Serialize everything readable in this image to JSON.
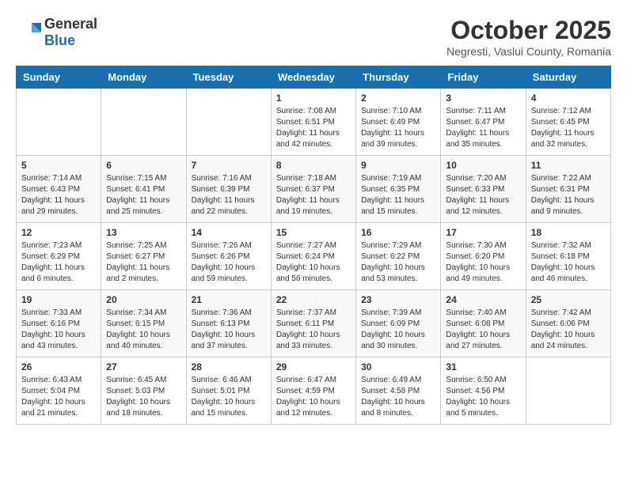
{
  "header": {
    "logo_general": "General",
    "logo_blue": "Blue",
    "month_title": "October 2025",
    "location": "Negresti, Vaslui County, Romania"
  },
  "days_of_week": [
    "Sunday",
    "Monday",
    "Tuesday",
    "Wednesday",
    "Thursday",
    "Friday",
    "Saturday"
  ],
  "weeks": [
    [
      {
        "day": "",
        "info": ""
      },
      {
        "day": "",
        "info": ""
      },
      {
        "day": "",
        "info": ""
      },
      {
        "day": "1",
        "info": "Sunrise: 7:08 AM\nSunset: 6:51 PM\nDaylight: 11 hours and 42 minutes."
      },
      {
        "day": "2",
        "info": "Sunrise: 7:10 AM\nSunset: 6:49 PM\nDaylight: 11 hours and 39 minutes."
      },
      {
        "day": "3",
        "info": "Sunrise: 7:11 AM\nSunset: 6:47 PM\nDaylight: 11 hours and 35 minutes."
      },
      {
        "day": "4",
        "info": "Sunrise: 7:12 AM\nSunset: 6:45 PM\nDaylight: 11 hours and 32 minutes."
      }
    ],
    [
      {
        "day": "5",
        "info": "Sunrise: 7:14 AM\nSunset: 6:43 PM\nDaylight: 11 hours and 29 minutes."
      },
      {
        "day": "6",
        "info": "Sunrise: 7:15 AM\nSunset: 6:41 PM\nDaylight: 11 hours and 25 minutes."
      },
      {
        "day": "7",
        "info": "Sunrise: 7:16 AM\nSunset: 6:39 PM\nDaylight: 11 hours and 22 minutes."
      },
      {
        "day": "8",
        "info": "Sunrise: 7:18 AM\nSunset: 6:37 PM\nDaylight: 11 hours and 19 minutes."
      },
      {
        "day": "9",
        "info": "Sunrise: 7:19 AM\nSunset: 6:35 PM\nDaylight: 11 hours and 15 minutes."
      },
      {
        "day": "10",
        "info": "Sunrise: 7:20 AM\nSunset: 6:33 PM\nDaylight: 11 hours and 12 minutes."
      },
      {
        "day": "11",
        "info": "Sunrise: 7:22 AM\nSunset: 6:31 PM\nDaylight: 11 hours and 9 minutes."
      }
    ],
    [
      {
        "day": "12",
        "info": "Sunrise: 7:23 AM\nSunset: 6:29 PM\nDaylight: 11 hours and 6 minutes."
      },
      {
        "day": "13",
        "info": "Sunrise: 7:25 AM\nSunset: 6:27 PM\nDaylight: 11 hours and 2 minutes."
      },
      {
        "day": "14",
        "info": "Sunrise: 7:26 AM\nSunset: 6:26 PM\nDaylight: 10 hours and 59 minutes."
      },
      {
        "day": "15",
        "info": "Sunrise: 7:27 AM\nSunset: 6:24 PM\nDaylight: 10 hours and 56 minutes."
      },
      {
        "day": "16",
        "info": "Sunrise: 7:29 AM\nSunset: 6:22 PM\nDaylight: 10 hours and 53 minutes."
      },
      {
        "day": "17",
        "info": "Sunrise: 7:30 AM\nSunset: 6:20 PM\nDaylight: 10 hours and 49 minutes."
      },
      {
        "day": "18",
        "info": "Sunrise: 7:32 AM\nSunset: 6:18 PM\nDaylight: 10 hours and 46 minutes."
      }
    ],
    [
      {
        "day": "19",
        "info": "Sunrise: 7:33 AM\nSunset: 6:16 PM\nDaylight: 10 hours and 43 minutes."
      },
      {
        "day": "20",
        "info": "Sunrise: 7:34 AM\nSunset: 6:15 PM\nDaylight: 10 hours and 40 minutes."
      },
      {
        "day": "21",
        "info": "Sunrise: 7:36 AM\nSunset: 6:13 PM\nDaylight: 10 hours and 37 minutes."
      },
      {
        "day": "22",
        "info": "Sunrise: 7:37 AM\nSunset: 6:11 PM\nDaylight: 10 hours and 33 minutes."
      },
      {
        "day": "23",
        "info": "Sunrise: 7:39 AM\nSunset: 6:09 PM\nDaylight: 10 hours and 30 minutes."
      },
      {
        "day": "24",
        "info": "Sunrise: 7:40 AM\nSunset: 6:08 PM\nDaylight: 10 hours and 27 minutes."
      },
      {
        "day": "25",
        "info": "Sunrise: 7:42 AM\nSunset: 6:06 PM\nDaylight: 10 hours and 24 minutes."
      }
    ],
    [
      {
        "day": "26",
        "info": "Sunrise: 6:43 AM\nSunset: 5:04 PM\nDaylight: 10 hours and 21 minutes."
      },
      {
        "day": "27",
        "info": "Sunrise: 6:45 AM\nSunset: 5:03 PM\nDaylight: 10 hours and 18 minutes."
      },
      {
        "day": "28",
        "info": "Sunrise: 6:46 AM\nSunset: 5:01 PM\nDaylight: 10 hours and 15 minutes."
      },
      {
        "day": "29",
        "info": "Sunrise: 6:47 AM\nSunset: 4:59 PM\nDaylight: 10 hours and 12 minutes."
      },
      {
        "day": "30",
        "info": "Sunrise: 6:49 AM\nSunset: 4:58 PM\nDaylight: 10 hours and 8 minutes."
      },
      {
        "day": "31",
        "info": "Sunrise: 6:50 AM\nSunset: 4:56 PM\nDaylight: 10 hours and 5 minutes."
      },
      {
        "day": "",
        "info": ""
      }
    ]
  ]
}
